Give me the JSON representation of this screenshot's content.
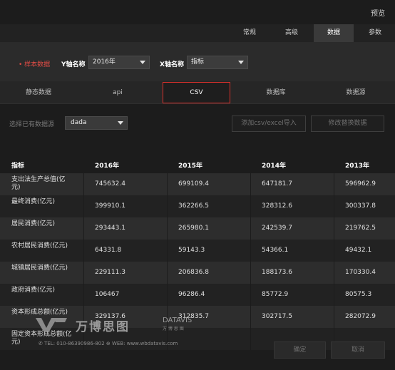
{
  "header": {
    "preview_label": "预览"
  },
  "settings_tabs": [
    "常规",
    "高级",
    "数据",
    "参数"
  ],
  "settings_active": "数据",
  "axes": {
    "sample_label": "• 样本数据",
    "y_label": "Y轴名称",
    "y_value": "2016年",
    "x_label": "X轴名称",
    "x_value": "指标"
  },
  "data_tabs": [
    "静态数据",
    "api",
    "CSV",
    "数据库",
    "数据源"
  ],
  "data_tab_active": "CSV",
  "source": {
    "label": "选择已有数据源",
    "value": "dada",
    "add_button": "添加csv/excel导入",
    "replace_button": "修改替换数据"
  },
  "table": {
    "headers": [
      "指标",
      "2016年",
      "2015年",
      "2014年",
      "2013年"
    ],
    "rows": [
      [
        "支出法生产总值(亿元)",
        "745632.4",
        "699109.4",
        "647181.7",
        "596962.9"
      ],
      [
        "最终消费(亿元)",
        "399910.1",
        "362266.5",
        "328312.6",
        "300337.8"
      ],
      [
        "居民消费(亿元)",
        "293443.1",
        "265980.1",
        "242539.7",
        "219762.5"
      ],
      [
        "农村居民消费(亿元)",
        "64331.8",
        "59143.3",
        "54366.1",
        "49432.1"
      ],
      [
        "城镇居民消费(亿元)",
        "229111.3",
        "206836.8",
        "188173.6",
        "170330.4"
      ],
      [
        "政府消费(亿元)",
        "106467",
        "96286.4",
        "85772.9",
        "80575.3"
      ],
      [
        "资本形成总额(亿元)",
        "329137.6",
        "312835.7",
        "302717.5",
        "282072.9"
      ],
      [
        "固定资本形成总额(亿元)",
        "",
        "",
        "",
        ""
      ]
    ]
  },
  "watermark": {
    "cn": "万博思图",
    "en": "DATAVIS",
    "en_sub": "万 博 思 图",
    "contact": "✆ TEL: 010-86390986-802   ⊕ WEB: www.wbdatavis.com"
  },
  "footer": {
    "confirm": "确定",
    "cancel": "取消"
  }
}
